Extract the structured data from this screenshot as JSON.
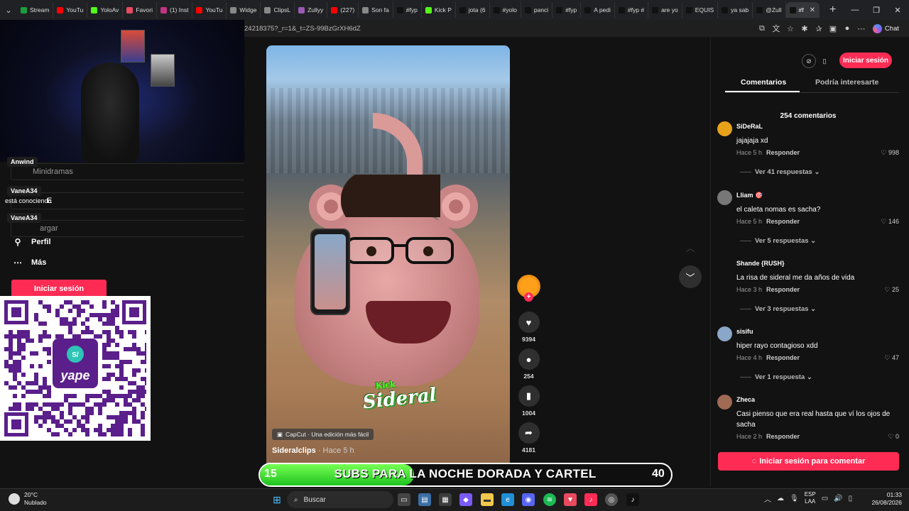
{
  "browser": {
    "tabs": [
      "Stream",
      "YouTu",
      "YoloAv",
      "Favori",
      "(1) Inst",
      "YouTu",
      "Widge",
      "ClipsL",
      "Zullyy",
      "(227)",
      "Son fa",
      "#fyp",
      "Kick P",
      "jota (6",
      "#yolo",
      "panci",
      "#fyp",
      "A pedi",
      "#fyp #",
      "are yo",
      "EQUIS",
      "ya sab",
      "@Zull",
      "#f"
    ],
    "url": "24218375?_r=1&_t=ZS-99BzGrXH6dZ",
    "chat_label": "Chat"
  },
  "overlay": {
    "sidebar_items": [
      "Minidramas",
      "E",
      "argar"
    ],
    "chat": [
      {
        "name": "Anwind",
        "message": ""
      },
      {
        "name": "VaneA34",
        "message": "está conociendo"
      },
      {
        "name": "VaneA34",
        "message": ""
      }
    ],
    "nav": [
      {
        "icon": "person-icon",
        "label": "Perfil"
      },
      {
        "icon": "more-icon",
        "label": "Más"
      }
    ],
    "login_label": "Iniciar sesión",
    "qr_brand": "yape"
  },
  "video": {
    "watermark_top": "Kick",
    "watermark": "Sideral",
    "capcut_label": "CapCut · Una edición más fácil",
    "author": "Sideralclips",
    "time": " · Hace 5 h",
    "likes": "9394",
    "comments": "254",
    "saves": "1004",
    "shares": "4181"
  },
  "goal": {
    "current": 15,
    "target": 40,
    "text": "SUBS PARA LA NOCHE DORADA Y CARTEL"
  },
  "panel": {
    "login_label": "Iniciar sesión",
    "tabs": [
      "Comentarios",
      "Podría interesarte"
    ],
    "count_label": "254 comentarios",
    "comments": [
      {
        "user": "SiDeRaL",
        "text": "jajajaja xd",
        "time": "Hace 5 h",
        "reply": "Responder",
        "likes": "998",
        "replies": "Ver 41 respuestas ⌄",
        "avatar_color": "#e8a21a"
      },
      {
        "user": "Lliam 🎯",
        "text": "el caleta nomas es sacha?",
        "time": "Hace 5 h",
        "reply": "Responder",
        "likes": "146",
        "replies": "Ver 5 respuestas ⌄",
        "avatar_color": "#777777"
      },
      {
        "user": "Shande {RUSH}",
        "text": "La risa de sideral me da años de vida",
        "time": "Hace 3 h",
        "reply": "Responder",
        "likes": "25",
        "replies": "Ver 3 respuestas ⌄",
        "avatar_color": "#121212"
      },
      {
        "user": "sisifu",
        "text": "hiper rayo contagioso xdd",
        "time": "Hace 4 h",
        "reply": "Responder",
        "likes": "47",
        "replies": "Ver 1 respuesta ⌄",
        "avatar_color": "#8aa6c8"
      },
      {
        "user": "Zheca",
        "text": "Casi pienso que era real hasta que ví los ojos de sacha",
        "time": "Hace 2 h",
        "reply": "Responder",
        "likes": "0",
        "replies": "",
        "avatar_color": "#a06a55"
      }
    ],
    "comment_login_label": "Iniciar sesión para comentar"
  },
  "taskbar": {
    "weather_temp": "20°C",
    "weather_desc": "Nublado",
    "search_label": "Buscar",
    "lang_top": "ESP",
    "lang_bottom": "LAA",
    "time": "01:33",
    "date": "26/08/2026"
  },
  "colors": {
    "brand_pink": "#fe2c55",
    "goal_green": "#2ecc2e",
    "background": "#121212"
  }
}
